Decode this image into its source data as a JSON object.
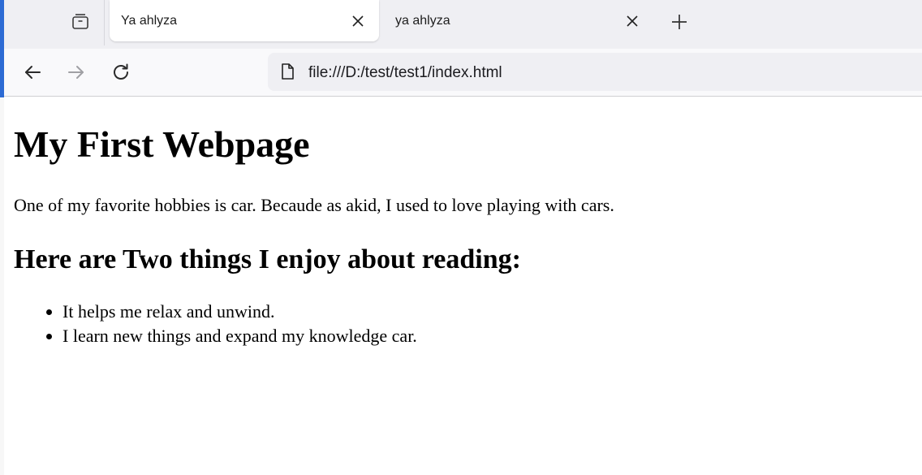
{
  "browser": {
    "tabs": [
      {
        "title": "Ya ahlyza",
        "active": true
      },
      {
        "title": "ya ahlyza",
        "active": false
      }
    ],
    "address_bar": {
      "url": "file:///D:/test/test1/index.html"
    },
    "icons": {
      "tab_group": "tab-group-icon",
      "close": "close-icon",
      "new_tab": "plus-icon",
      "back": "back-arrow-icon",
      "forward": "forward-arrow-icon",
      "reload": "reload-icon",
      "page": "page-icon"
    }
  },
  "page": {
    "heading": "My First Webpage",
    "paragraph": "One of my favorite hobbies is car. Becaude as akid, I used to love playing with cars.",
    "subheading": "Here are Two things I enjoy about reading:",
    "list": [
      "It helps me relax and unwind.",
      "I learn new things and expand my knowledge car."
    ]
  },
  "colors": {
    "tabstrip_bg": "#efeff3",
    "toolbar_bg": "#f9f9fb",
    "urlbar_bg": "#efeff3",
    "window_edge": "#2d6bd4"
  }
}
